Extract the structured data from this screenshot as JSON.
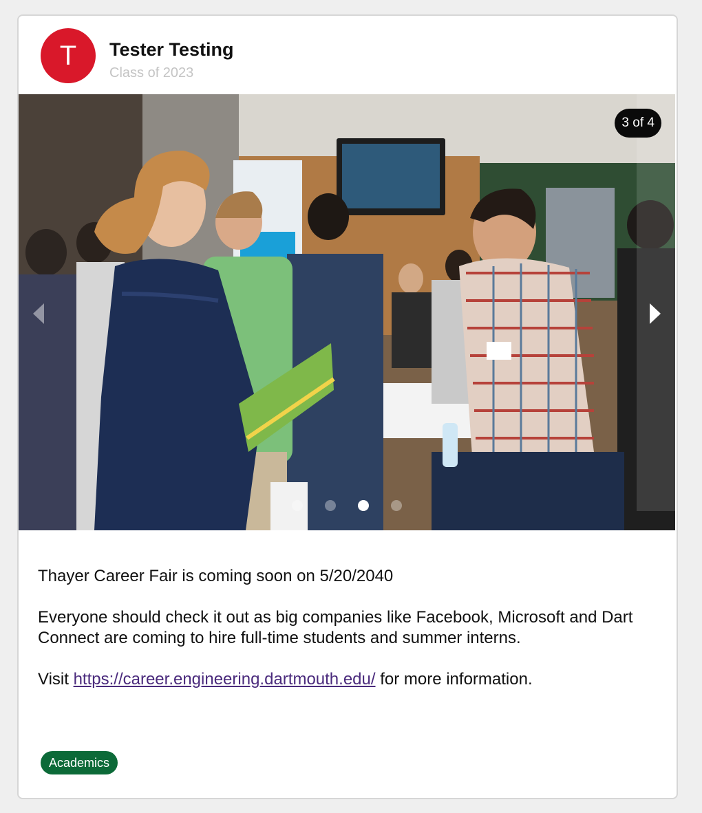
{
  "post": {
    "author": {
      "initial": "T",
      "name": "Tester Testing",
      "class_year": "Class of 2023"
    },
    "carousel": {
      "current": 3,
      "total": 4,
      "counter_current": "3",
      "counter_of": "of",
      "counter_total": "4",
      "image_icon": "photo-career-fair"
    },
    "content": {
      "line1": "Thayer Career Fair is coming soon on 5/20/2040",
      "line2": "Everyone should check it out as big companies like Facebook, Microsoft and Dart Connect are coming to hire full-time students and summer interns.",
      "visit_prefix": "Visit",
      "link_text": "https://career.engineering.dartmouth.edu/",
      "visit_suffix": "for more information."
    },
    "tags": [
      "Academics"
    ]
  },
  "colors": {
    "avatar": "#d9182a",
    "tag": "#0c6a38",
    "link": "#4a2a7c",
    "page_bg": "#efefef",
    "card_border": "#d6d6d6"
  }
}
